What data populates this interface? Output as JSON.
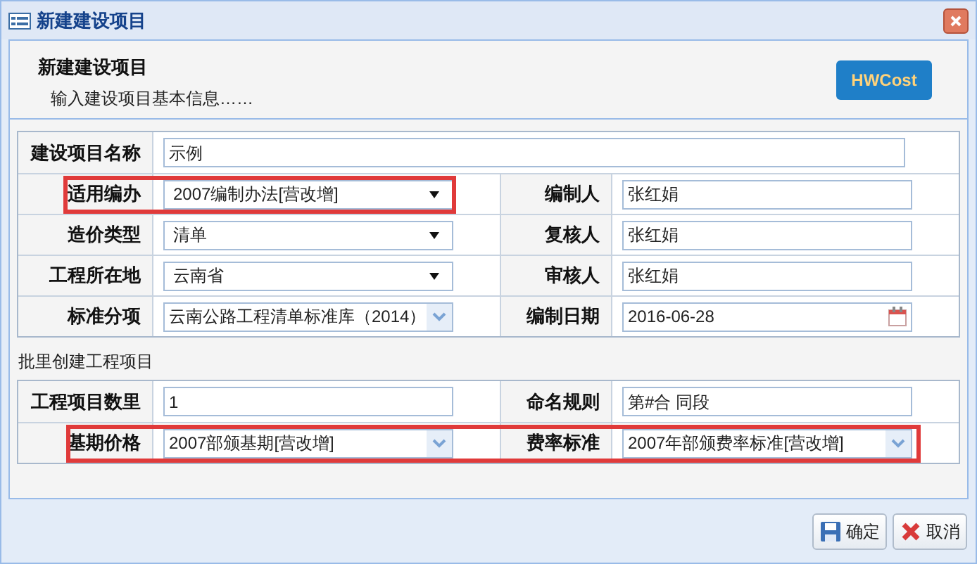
{
  "window": {
    "title": "新建建设项目"
  },
  "header": {
    "title": "新建建设项目",
    "subtitle": "输入建设项目基本信息……",
    "logo": "HWCost"
  },
  "form": {
    "rows": [
      {
        "cells": [
          {
            "label": "建设项目名称",
            "kind": "text",
            "value": "示例",
            "highlighted": false
          }
        ]
      },
      {
        "cells": [
          {
            "label": "适用编办",
            "kind": "select",
            "value": "2007编制办法[营改增]",
            "highlighted": true
          },
          {
            "label": "编制人",
            "kind": "text",
            "value": "张红娟",
            "highlighted": false
          }
        ]
      },
      {
        "cells": [
          {
            "label": "造价类型",
            "kind": "select",
            "value": "清单",
            "highlighted": false
          },
          {
            "label": "复核人",
            "kind": "text",
            "value": "张红娟",
            "highlighted": false
          }
        ]
      },
      {
        "cells": [
          {
            "label": "工程所在地",
            "kind": "select",
            "value": "云南省",
            "highlighted": false
          },
          {
            "label": "审核人",
            "kind": "text",
            "value": "张红娟",
            "highlighted": false
          }
        ]
      },
      {
        "cells": [
          {
            "label": "标准分项",
            "kind": "combo",
            "value": "云南公路工程清单标准库（2014）",
            "highlighted": false
          },
          {
            "label": "编制日期",
            "kind": "date",
            "value": "2016-06-28",
            "highlighted": false
          }
        ]
      }
    ]
  },
  "batch": {
    "title": "批里创建工程项目",
    "rows": [
      {
        "cells": [
          {
            "label": "工程项目数里",
            "kind": "text",
            "value": "1",
            "highlighted": false
          },
          {
            "label": "命名规则",
            "kind": "text",
            "value": "第#合 同段",
            "highlighted": false
          }
        ]
      },
      {
        "cells": [
          {
            "label": "基期价格",
            "kind": "combo",
            "value": "2007部颁基期[营改增]",
            "highlighted": true
          },
          {
            "label": "费率标准",
            "kind": "combo",
            "value": "2007年部颁费率标准[营改增]",
            "highlighted": true
          }
        ]
      }
    ]
  },
  "buttons": [
    {
      "kind": "ok",
      "label": "确定"
    },
    {
      "kind": "cancel",
      "label": "取消"
    }
  ]
}
